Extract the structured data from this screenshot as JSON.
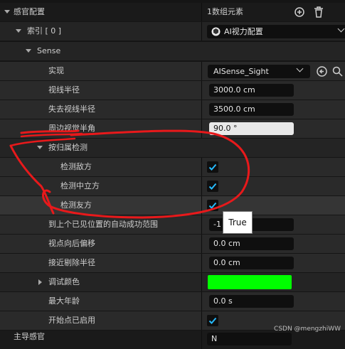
{
  "sense_config": {
    "label": "感官配置",
    "count": "1数组元素",
    "add_icon": "plus-circle-icon",
    "delete_icon": "trash-icon"
  },
  "index_row": {
    "label": "索引 [ 0 ]",
    "value": "AI视力配置",
    "value_icon": "config-asset-icon"
  },
  "sense": {
    "label": "Sense"
  },
  "implementation": {
    "label": "实现",
    "value": "AISense_Sight",
    "back_icon": "arrow-left-circle-icon",
    "browse_icon": "search-icon"
  },
  "properties": [
    {
      "label": "视线半径",
      "value": "3000.0 cm"
    },
    {
      "label": "失去视线半径",
      "value": "3500.0 cm"
    },
    {
      "label": "周边视觉半角",
      "value": "90.0 °"
    }
  ],
  "affiliation": {
    "label": "按归属检测",
    "items": [
      {
        "label": "检测敌方",
        "checked": true
      },
      {
        "label": "检测中立方",
        "checked": true
      },
      {
        "label": "检测友方",
        "checked": true
      }
    ]
  },
  "tooltip": {
    "text": "True"
  },
  "more_properties": [
    {
      "label": "到上个已见位置的自动成功范围",
      "value": "-1"
    },
    {
      "label": "视点向后偏移",
      "value": "0.0 cm"
    },
    {
      "label": "接近剔除半径",
      "value": "0.0 cm"
    }
  ],
  "debug_color": {
    "label": "调试颜色",
    "color": "#00ff00"
  },
  "max_age": {
    "label": "最大年龄",
    "value": "0.0 s"
  },
  "start_enabled": {
    "label": "开始点已启用",
    "checked": true
  },
  "bottom_row": {
    "label": "主导感官",
    "value": "N"
  },
  "watermark": "CSDN @mengzhiWW",
  "colors": {
    "checkbox_blue": "#26bbff",
    "annotation_red": "#e8191b"
  }
}
